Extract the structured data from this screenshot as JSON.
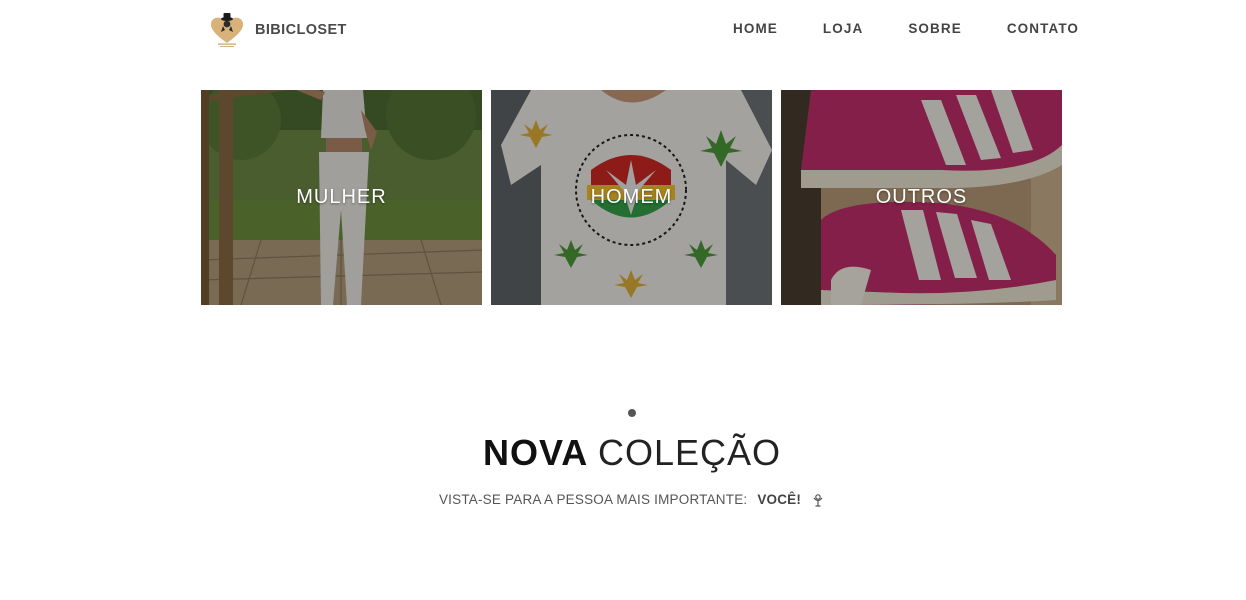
{
  "header": {
    "brand_name": "BIBICLOSET",
    "logo_icon": "heart-hat-logo-icon",
    "nav": [
      {
        "label": "HOME"
      },
      {
        "label": "LOJA"
      },
      {
        "label": "SOBRE"
      },
      {
        "label": "CONTATO"
      }
    ]
  },
  "categories": [
    {
      "label": "MULHER",
      "image": "woman-white-crochet-outfit-photo"
    },
    {
      "label": "HOMEM",
      "image": "man-leaf-print-tshirt-photo"
    },
    {
      "label": "OUTROS",
      "image": "pink-sneakers-in-box-photo"
    }
  ],
  "collection": {
    "title_bold": "NOVA",
    "title_light": "COLEÇÃO",
    "subtitle": "VISTA-SE PARA A PESSOA MAIS IMPORTANTE:",
    "subtitle_emphasis": "VOCÊ!",
    "subtitle_icon": "flower-icon"
  },
  "colors": {
    "text_dark": "#111111",
    "nav_text": "#444444",
    "overlay": "rgba(0,0,0,0.32)"
  }
}
